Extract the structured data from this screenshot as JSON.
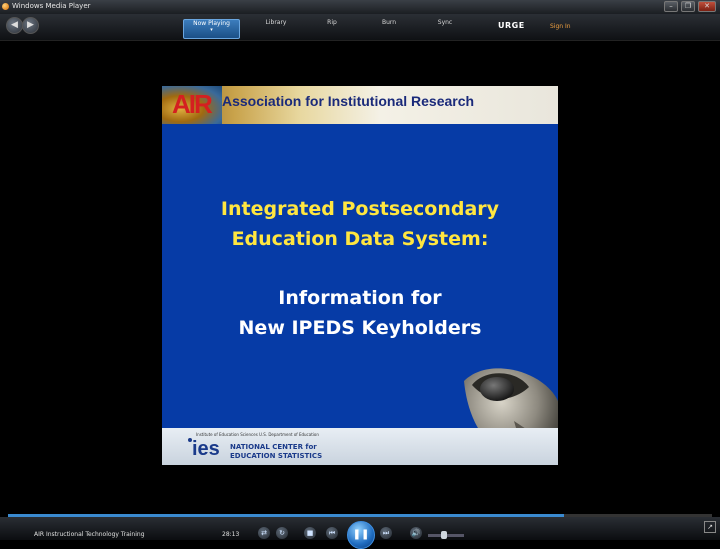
{
  "window": {
    "title": "Windows Media Player",
    "min_label": "–",
    "restore_label": "❐",
    "close_label": "✕"
  },
  "toolbar": {
    "back_label": "◀",
    "forward_label": "▶",
    "tabs": [
      {
        "label": "Now Playing",
        "active": true
      },
      {
        "label": "Library",
        "active": false
      },
      {
        "label": "Rip",
        "active": false
      },
      {
        "label": "Burn",
        "active": false
      },
      {
        "label": "Sync",
        "active": false
      }
    ],
    "store_label": "URGE",
    "signin_label": "Sign In"
  },
  "slide": {
    "logo_text": "AIR",
    "header": "Association for Institutional Research",
    "title_line1": "Integrated Postsecondary",
    "title_line2": "Education Data System:",
    "subtitle_line1": "Information for",
    "subtitle_line2": "New IPEDS Keyholders",
    "footer_small": "Institute of Education Sciences  U.S. Department of Education",
    "footer_logo": "ies",
    "footer_nces1": "NATIONAL CENTER for",
    "footer_nces2": "EDUCATION STATISTICS"
  },
  "controls": {
    "now_playing_title": "AIR Instructional Technology Training",
    "time": "28:13",
    "progress_fraction": 0.79,
    "volume_fraction": 0.45,
    "shuffle_label": "⇄",
    "repeat_label": "↻",
    "stop_label": "■",
    "prev_label": "⏮",
    "play_label": "❚❚",
    "next_label": "⏭",
    "mute_label": "🔊",
    "mini_label": "↗",
    "accent_color": "#3a8ad0"
  }
}
